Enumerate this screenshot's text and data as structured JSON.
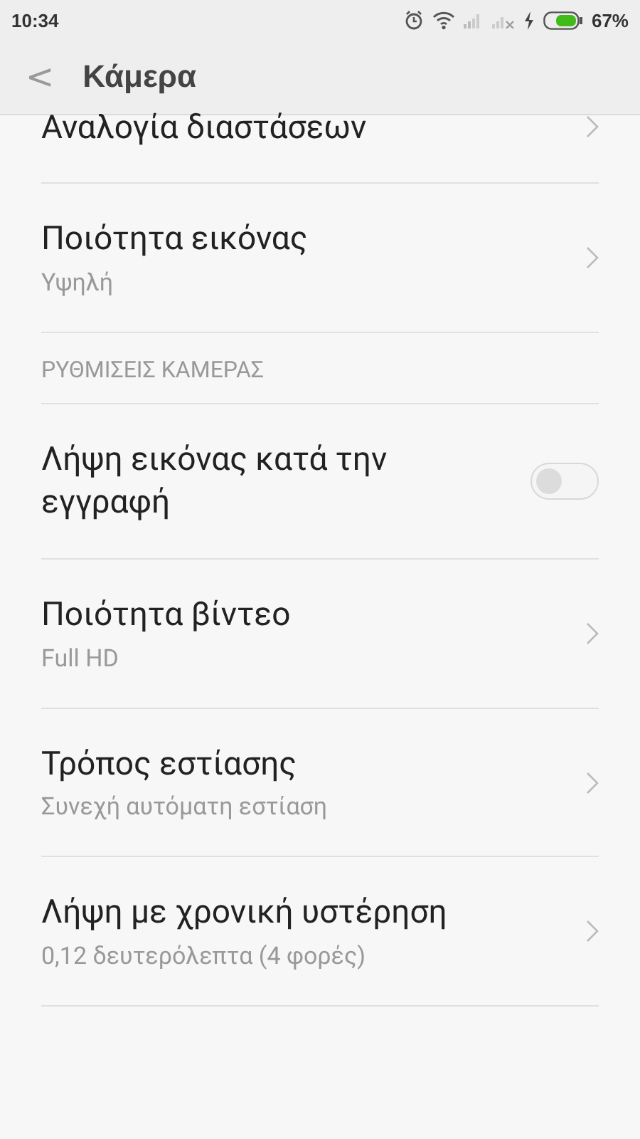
{
  "status_bar": {
    "time": "10:34",
    "battery": "67%"
  },
  "header": {
    "back": "<",
    "title": "Κάμερα"
  },
  "rows": [
    {
      "kind": "nav",
      "title": "Αναλογία διαστάσεων"
    },
    {
      "kind": "nav",
      "title": "Ποιότητα εικόνας",
      "value": "Υψηλή"
    },
    {
      "kind": "section",
      "title": "ΡΥΘΜΙΣΕΙΣ ΚΑΜΕΡΑΣ"
    },
    {
      "kind": "toggle",
      "title": "Λήψη εικόνας κατά την εγγραφή",
      "on": false
    },
    {
      "kind": "nav",
      "title": "Ποιότητα βίντεο",
      "value": "Full HD"
    },
    {
      "kind": "nav",
      "title": "Τρόπος εστίασης",
      "value": "Συνεχή αυτόματη εστίαση"
    },
    {
      "kind": "nav",
      "title": "Λήψη με χρονική υστέρηση",
      "value": "0,12 δευτερόλεπτα (4 φορές)"
    }
  ]
}
